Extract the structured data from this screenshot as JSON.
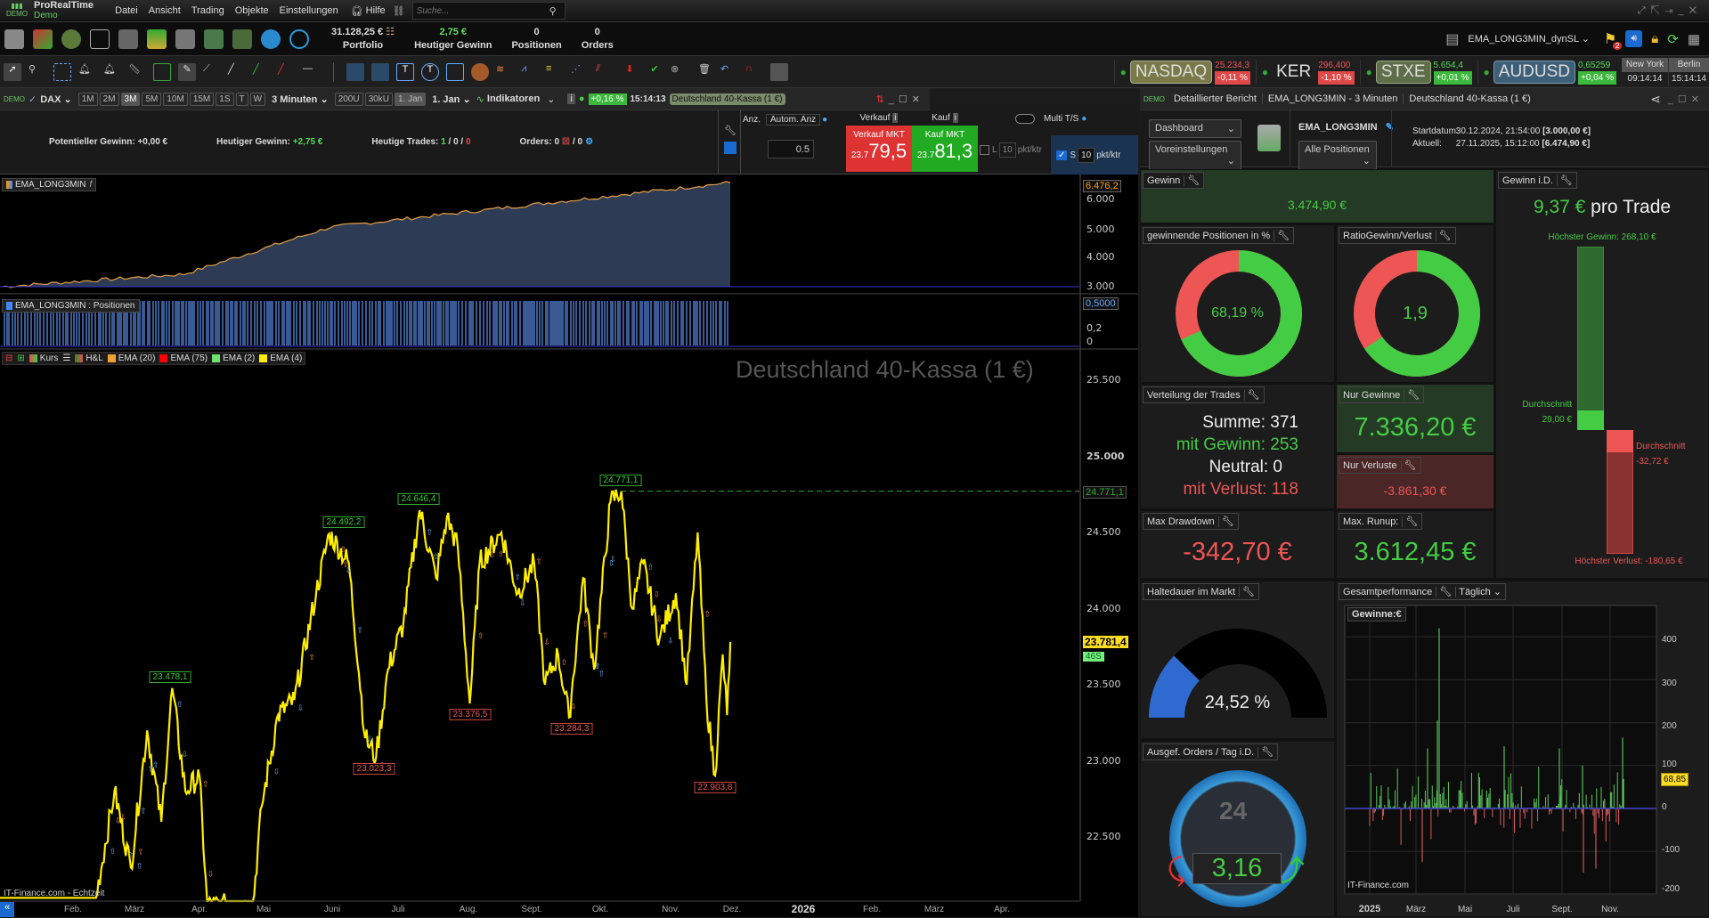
{
  "app": {
    "name": "ProRealTime",
    "mode": "Demo",
    "menu": [
      "Datei",
      "Ansicht",
      "Trading",
      "Objekte",
      "Einstellungen"
    ],
    "help": "Hilfe",
    "search_placeholder": "Suche..."
  },
  "account": {
    "portfolio_value": "31.128,25 €",
    "portfolio_label": "Portfolio",
    "today_gain": "2,75 €",
    "today_gain_label": "Heutiger Gewinn",
    "positions": "0",
    "positions_label": "Positionen",
    "orders": "0",
    "orders_label": "Orders"
  },
  "system_selector": "EMA_LONG3MIN_dynSL",
  "flag_count": "2",
  "tickers": [
    {
      "name": "NASDAQ",
      "price": "25.234,3",
      "change": "-0,11 %",
      "dir": "down",
      "color": "#8a8a55"
    },
    {
      "name": "KER",
      "price": "296,400",
      "change": "-1,10 %",
      "dir": "down",
      "color": "transparent"
    },
    {
      "name": "STXE",
      "price": "5.654,4",
      "change": "+0,01 %",
      "dir": "up",
      "color": "#6b7a55"
    },
    {
      "name": "AUDUSD",
      "price": "0,65259",
      "change": "+0,04 %",
      "dir": "up",
      "color": "#3e5f78"
    }
  ],
  "clocks": [
    {
      "city": "New York",
      "time": "09:14:14"
    },
    {
      "city": "Berlin",
      "time": "15:14:14"
    }
  ],
  "chart_toolbar": {
    "instrument": "DAX",
    "timeframes": [
      "1M",
      "2M",
      "3M",
      "5M",
      "10M",
      "15M",
      "1S",
      "T",
      "W"
    ],
    "active_timeframe": "3M",
    "interval": "3 Minuten",
    "units": [
      "200U",
      "30kU",
      "1. Jan"
    ],
    "from": "1. Jan",
    "indicators": "Indikatoren",
    "change": "+0,16 %",
    "time": "15:14:13",
    "instrument_full": "Deutschland 40-Kassa (1 €)"
  },
  "trade_bar": {
    "potential_label": "Potentieller Gewinn:",
    "potential": "+0,00 €",
    "today_label": "Heutiger Gewinn:",
    "today": "+2,75 €",
    "trades_label": "Heutige Trades:",
    "trades_win": "1",
    "trades_neutral": "0",
    "trades_loss": "0",
    "orders_label": "Orders:",
    "orders_a": "0",
    "orders_b": "/ 0",
    "anz": "Anz.",
    "auto_anz": "Autom. Anz",
    "qty": "0.5",
    "sell_header": "Verkauf",
    "buy_header": "Kauf",
    "sell_label": "Verkauf MKT",
    "buy_label": "Kauf MKT",
    "sell_prefix": "23.7",
    "sell_price": "79,5",
    "buy_prefix": "23.7",
    "buy_price": "81,3",
    "multi": "Multi T/S",
    "l": "L",
    "l_val": "10",
    "s": "S",
    "s_val": "10",
    "unit": "pkt/ktr"
  },
  "equity_panel": {
    "label": "EMA_LONG3MIN",
    "last": "6.476,2",
    "ticks": [
      "6.000",
      "5.000",
      "4.000",
      "3.000"
    ],
    "start": 3000,
    "end": 6476.2
  },
  "positions_panel": {
    "label": "EMA_LONG3MIN : Positionen",
    "last": "0,5000",
    "ticks": [
      "0,2",
      "0"
    ]
  },
  "price_chart": {
    "legend": [
      "Kurs",
      "H&L",
      "EMA (20)",
      "EMA (75)",
      "EMA (2)",
      "EMA (4)"
    ],
    "legend_colors": [
      "#e05050",
      "#2a8a2a",
      "#f0a030",
      "#ff0000",
      "#70e070",
      "#ffee00"
    ],
    "watermark": "Deutschland 40-Kassa (1 €)",
    "y_ticks": [
      "25.500",
      "25.000",
      "24.500",
      "24.000",
      "23.500",
      "23.000",
      "22.500"
    ],
    "last_price": "23.781,4",
    "badge": "46S",
    "resistance": "24.771,1",
    "highs": [
      "23.478,1",
      "24.492,2",
      "24.646,4",
      "24.771,1"
    ],
    "lows": [
      "23.023,3",
      "23.376,5",
      "23.284,3",
      "22.903,8"
    ],
    "x_labels": [
      "Feb.",
      "März",
      "Apr.",
      "Mai",
      "Juni",
      "Juli",
      "Aug.",
      "Sept.",
      "Okt.",
      "Nov.",
      "Dez.",
      "2026",
      "Feb.",
      "März",
      "Apr."
    ],
    "source": "IT-Finance.com - Echtzeit"
  },
  "report": {
    "tabs": [
      "Detaillierter Bericht",
      "EMA_LONG3MIN - 3 Minuten",
      "Deutschland 40-Kassa (1 €)"
    ],
    "view": "Dashboard",
    "presets": "Voreinstellungen",
    "system": "EMA_LONG3MIN",
    "filter": "Alle Positionen",
    "start_label": "Startdatum:",
    "start": "30.12.2024, 21:54:00",
    "start_capital": "[3.000,00 €]",
    "current_label": "Aktuell:",
    "current": "27.11.2025, 15:12:00",
    "current_capital": "[6.474,90 €]"
  },
  "widgets": {
    "gewinn": {
      "title": "Gewinn",
      "value": "3.474,90 €"
    },
    "winning": {
      "title": "gewinnende Positionen in %",
      "value": "68,19 %",
      "fraction": 0.6819
    },
    "ratio": {
      "title": "RatioGewinn/Verlust",
      "value": "1,9",
      "ratio": 1.9
    },
    "distribution": {
      "title": "Verteilung der Trades",
      "sum": "Summe: 371",
      "win": "mit Gewinn: 253",
      "neutral": "Neutral: 0",
      "loss": "mit Verlust: 118"
    },
    "only_gains": {
      "title": "Nur Gewinne",
      "value": "7.336,20 €"
    },
    "only_losses": {
      "title": "Nur Verluste",
      "value": "-3.861,30 €"
    },
    "drawdown": {
      "title": "Max Drawdown",
      "value": "-342,70 €"
    },
    "runup": {
      "title": "Max. Runup:",
      "value": "3.612,45 €"
    },
    "per_trade": {
      "title": "Gewinn i.D.",
      "value": "9,37 €",
      "suffix": "pro Trade",
      "max_gain": "Höchster Gewinn: 268,10 €",
      "avg_label": "Durchschnitt",
      "avg_gain": "29,00 €",
      "avg_loss": "-32,72 €",
      "max_loss": "Höchster Verlust: -180,65 €",
      "max_gain_v": 268.1,
      "avg_gain_v": 29,
      "avg_loss_v": -32.72,
      "max_loss_v": -180.65
    },
    "time_in_market": {
      "title": "Haltedauer im Markt",
      "value": "24,52 %",
      "fraction": 0.2452
    },
    "orders_day": {
      "title": "Ausgef. Orders / Tag i.D.",
      "value": "3,16",
      "clock": "24"
    },
    "performance": {
      "title": "Gesamtperformance",
      "period": "Täglich",
      "legend": "Gewinne:€",
      "y_ticks": [
        "400",
        "300",
        "200",
        "100",
        "0",
        "-100",
        "-200"
      ],
      "x_labels": [
        "2025",
        "März",
        "Mai",
        "Juli",
        "Sept.",
        "Nov."
      ],
      "last": "68,85",
      "source": "IT-Finance.com"
    }
  }
}
